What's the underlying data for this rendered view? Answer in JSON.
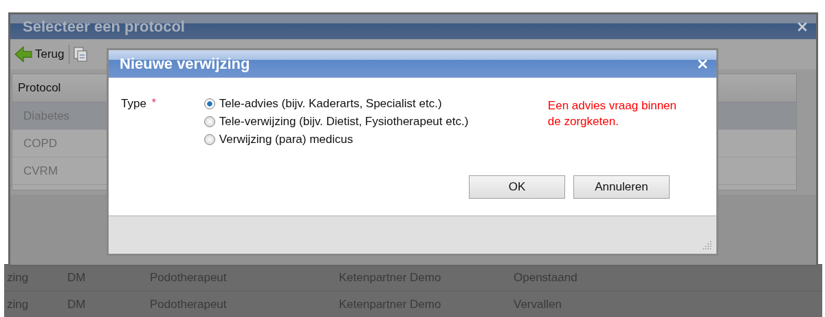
{
  "background_table": {
    "rows": [
      {
        "cells": [
          "zing",
          "DM",
          "Podotherapeut",
          "Ketenpartner Demo",
          "Openstaand"
        ]
      },
      {
        "cells": [
          "zing",
          "DM",
          "Podotherapeut",
          "Ketenpartner Demo",
          "Vervallen"
        ]
      }
    ]
  },
  "protocol_window": {
    "title": "Selecteer een protocol",
    "toolbar": {
      "back_label": "Terug"
    },
    "grid": {
      "column": "Protocol",
      "rows": [
        {
          "label": "Diabetes",
          "selected": true
        },
        {
          "label": "COPD",
          "selected": false
        },
        {
          "label": "CVRM",
          "selected": false
        }
      ]
    }
  },
  "dialog": {
    "title": "Nieuwe verwijzing",
    "field_label": "Type",
    "required_mark": "*",
    "options": [
      {
        "label": "Tele-advies (bijv. Kaderarts, Specialist etc.)",
        "selected": true
      },
      {
        "label": "Tele-verwijzing (bijv. Dietist, Fysiotherapeut etc.)",
        "selected": false
      },
      {
        "label": "Verwijzing (para) medicus",
        "selected": false
      }
    ],
    "hint": "Een advies vraag binnen de zorgketen.",
    "buttons": [
      "OK",
      "Annuleren"
    ]
  }
}
